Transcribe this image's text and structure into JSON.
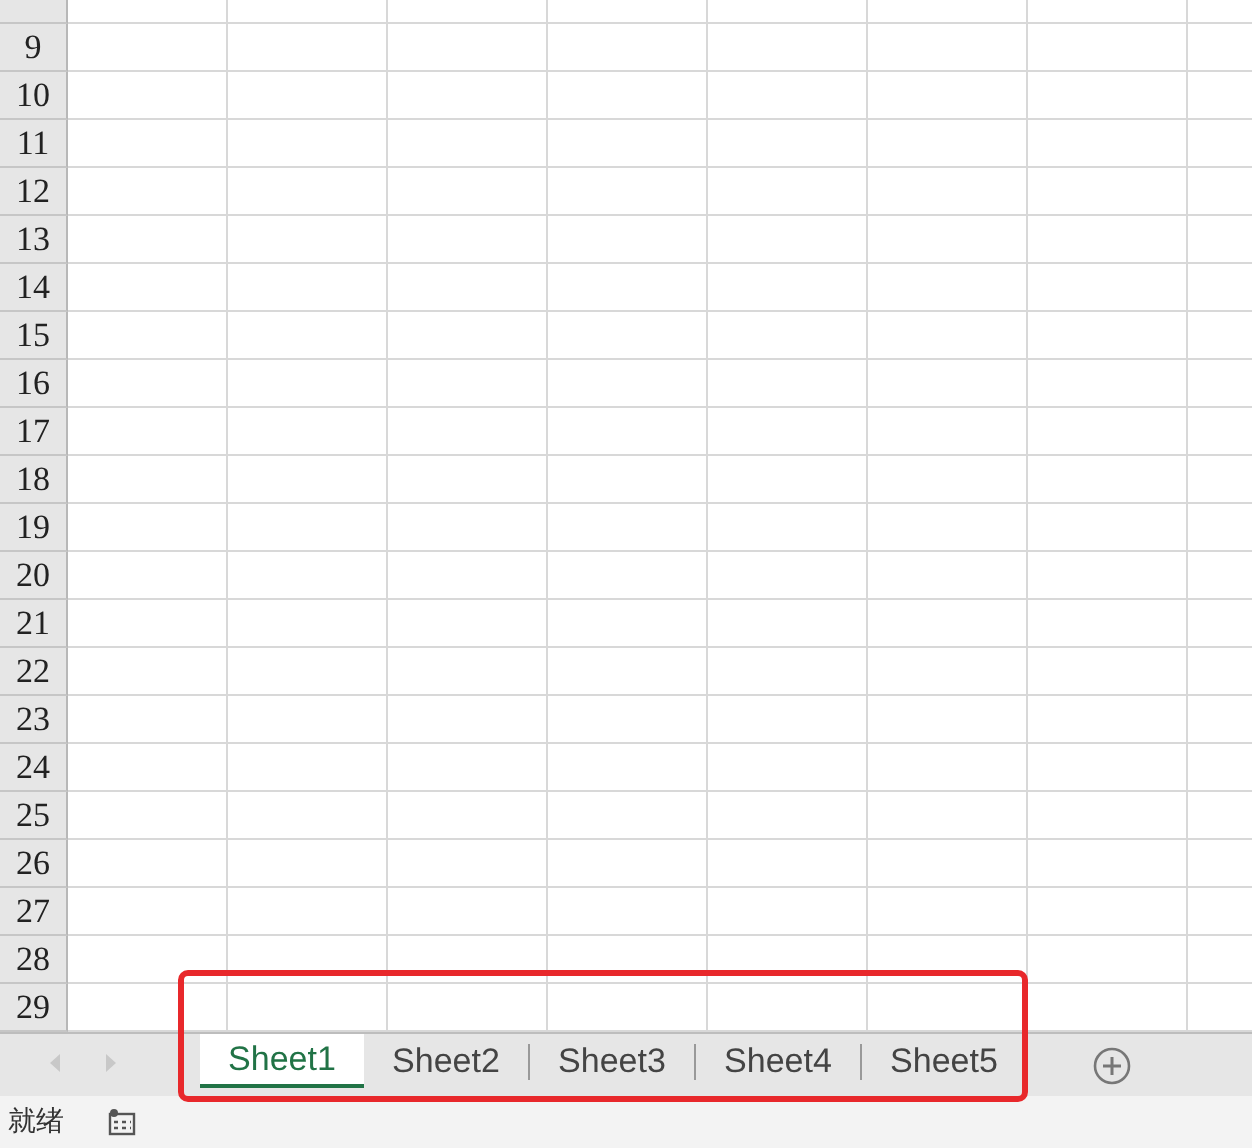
{
  "row_headers": [
    "9",
    "10",
    "11",
    "12",
    "13",
    "14",
    "15",
    "16",
    "17",
    "18",
    "19",
    "20",
    "21",
    "22",
    "23",
    "24",
    "25",
    "26",
    "27",
    "28",
    "29"
  ],
  "sheet_tabs": [
    {
      "label": "Sheet1",
      "selected": true
    },
    {
      "label": "Sheet2",
      "selected": false
    },
    {
      "label": "Sheet3",
      "selected": false
    },
    {
      "label": "Sheet4",
      "selected": false
    },
    {
      "label": "Sheet5",
      "selected": false
    }
  ],
  "status_bar": {
    "status": "就绪"
  }
}
